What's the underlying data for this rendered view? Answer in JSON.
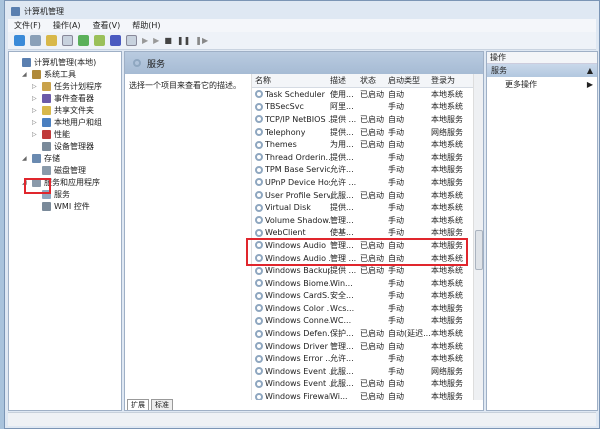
{
  "title": "计算机管理",
  "menu": [
    "文件(F)",
    "操作(A)",
    "查看(V)",
    "帮助(H)"
  ],
  "tree": [
    {
      "label": "计算机管理(本地)",
      "level": 0,
      "arrow": "",
      "color": "#5a7fb0"
    },
    {
      "label": "系统工具",
      "level": 1,
      "arrow": "◢",
      "color": "#b08a3a"
    },
    {
      "label": "任务计划程序",
      "level": 2,
      "arrow": "▷",
      "color": "#c9a24a"
    },
    {
      "label": "事件查看器",
      "level": 2,
      "arrow": "▷",
      "color": "#6b5aa8"
    },
    {
      "label": "共享文件夹",
      "level": 2,
      "arrow": "▷",
      "color": "#d8b84a"
    },
    {
      "label": "本地用户和组",
      "level": 2,
      "arrow": "▷",
      "color": "#4a7fc0"
    },
    {
      "label": "性能",
      "level": 2,
      "arrow": "▷",
      "color": "#c03a3a"
    },
    {
      "label": "设备管理器",
      "level": 2,
      "arrow": "",
      "color": "#7a8a9a"
    },
    {
      "label": "存储",
      "level": 1,
      "arrow": "◢",
      "color": "#6a8ab0"
    },
    {
      "label": "磁盘管理",
      "level": 2,
      "arrow": "",
      "color": "#8a9aaa"
    },
    {
      "label": "服务和应用程序",
      "level": 1,
      "arrow": "◢",
      "color": "#8a9aaa"
    },
    {
      "label": "服务",
      "level": 2,
      "arrow": "",
      "color": "#8fa7c0"
    },
    {
      "label": "WMI 控件",
      "level": 2,
      "arrow": "",
      "color": "#7a8a9a"
    }
  ],
  "middle": {
    "header": "服务",
    "description": "选择一个项目来查看它的描述。",
    "columns": [
      "名称",
      "描述",
      "状态",
      "启动类型",
      "登录为"
    ],
    "rows": [
      [
        "Task Scheduler",
        "使用...",
        "已启动",
        "自动",
        "本地系统"
      ],
      [
        "TBSecSvc",
        "阿里...",
        "",
        "手动",
        "本地系统"
      ],
      [
        "TCP/IP NetBIOS ...",
        "提供 ...",
        "已启动",
        "自动",
        "本地服务"
      ],
      [
        "Telephony",
        "提供...",
        "已启动",
        "手动",
        "网络服务"
      ],
      [
        "Themes",
        "为用...",
        "已启动",
        "自动",
        "本地系统"
      ],
      [
        "Thread Orderin...",
        "提供...",
        "",
        "手动",
        "本地服务"
      ],
      [
        "TPM Base Servic...",
        "允许...",
        "",
        "手动",
        "本地服务"
      ],
      [
        "UPnP Device Host",
        "允许 ...",
        "",
        "手动",
        "本地服务"
      ],
      [
        "User Profile Serv...",
        "此服...",
        "已启动",
        "自动",
        "本地系统"
      ],
      [
        "Virtual Disk",
        "提供...",
        "",
        "手动",
        "本地系统"
      ],
      [
        "Volume Shadow...",
        "管理...",
        "",
        "手动",
        "本地系统"
      ],
      [
        "WebClient",
        "使基...",
        "",
        "手动",
        "本地服务"
      ],
      [
        "Windows Audio",
        "管理...",
        "已启动",
        "自动",
        "本地服务"
      ],
      [
        "Windows Audio ...",
        "管理 ...",
        "已启动",
        "自动",
        "本地系统"
      ],
      [
        "Windows Backup",
        "提供 ...",
        "已启动",
        "手动",
        "本地系统"
      ],
      [
        "Windows Biome...",
        "Win...",
        "",
        "手动",
        "本地系统"
      ],
      [
        "Windows CardS...",
        "安全...",
        "",
        "手动",
        "本地系统"
      ],
      [
        "Windows Color ...",
        "Wcs...",
        "",
        "手动",
        "本地服务"
      ],
      [
        "Windows Conne...",
        "WC...",
        "",
        "手动",
        "本地服务"
      ],
      [
        "Windows Defen...",
        "保护...",
        "已启动",
        "自动(延迟...",
        "本地系统"
      ],
      [
        "Windows Driver ...",
        "管理...",
        "已启动",
        "自动",
        "本地系统"
      ],
      [
        "Windows Error ...",
        "允许...",
        "",
        "手动",
        "本地系统"
      ],
      [
        "Windows Event ...",
        "此服...",
        "",
        "手动",
        "网络服务"
      ],
      [
        "Windows Event ...",
        "此服...",
        "已启动",
        "自动",
        "本地服务"
      ],
      [
        "Windows Firewall",
        "Wi...",
        "已启动",
        "自动",
        "本地服务"
      ]
    ],
    "tabs": [
      "扩展",
      "标准"
    ]
  },
  "actions": {
    "header": "操作",
    "section": "服务",
    "item": "更多操作"
  }
}
